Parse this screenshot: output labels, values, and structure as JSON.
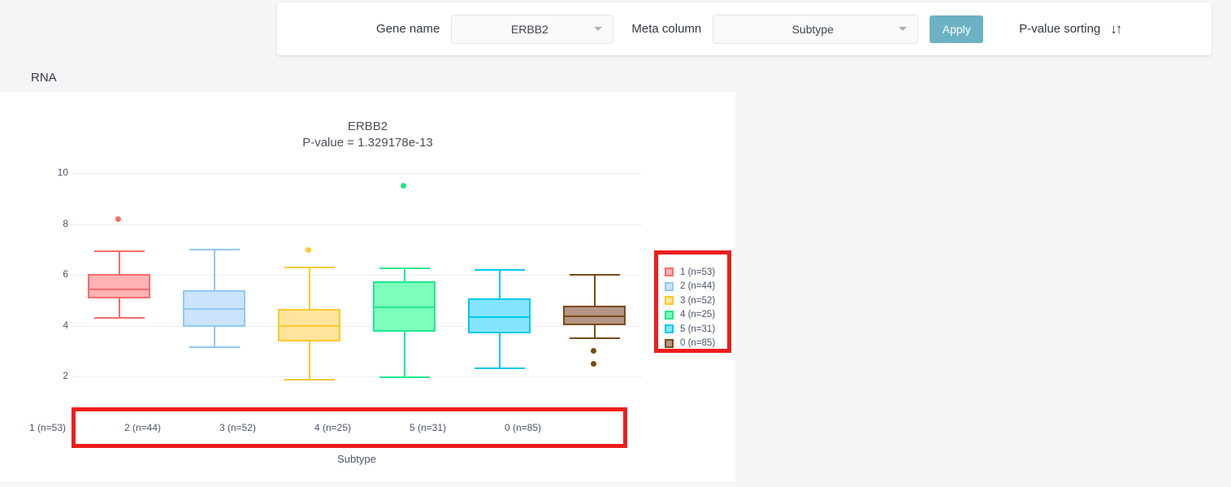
{
  "toolbar": {
    "gene_label": "Gene name",
    "gene_value": "ERBB2",
    "meta_label": "Meta column",
    "meta_value": "Subtype",
    "apply_label": "Apply",
    "pvalue_sorting_label": "P-value sorting",
    "sort_icon": "↓↑"
  },
  "section": {
    "title": "RNA"
  },
  "chart_data": {
    "type": "box",
    "title": "ERBB2",
    "subtitle": "P-value = 1.329178e-13",
    "xlabel": "Subtype",
    "ylabel": "",
    "ylim": [
      2,
      10.6
    ],
    "yticks": [
      2,
      4,
      6,
      8,
      10
    ],
    "grid": true,
    "legend_position": "right",
    "categories": [
      "1 (n=53)",
      "2 (n=44)",
      "3 (n=52)",
      "4 (n=25)",
      "5 (n=31)",
      "0 (n=85)"
    ],
    "legend": [
      {
        "label": "1 (n=53)",
        "fill": "#FFB3B3",
        "stroke": "#FF6B6B"
      },
      {
        "label": "2 (n=44)",
        "fill": "#CBE4FB",
        "stroke": "#8FC8F7"
      },
      {
        "label": "3 (n=52)",
        "fill": "#FFE59B",
        "stroke": "#FFC92E"
      },
      {
        "label": "4 (n=25)",
        "fill": "#7DFFBE",
        "stroke": "#1FE98B"
      },
      {
        "label": "5 (n=31)",
        "fill": "#85E5FF",
        "stroke": "#00C8F0"
      },
      {
        "label": "0 (n=85)",
        "fill": "#B49686",
        "stroke": "#7B4B16"
      }
    ],
    "boxes": [
      {
        "name": "1 (n=53)",
        "fill": "#FFB3B3",
        "stroke": "#FF6B6B",
        "whisker_low": 4.33,
        "q1": 5.08,
        "median": 5.47,
        "q3": 6.02,
        "whisker_high": 6.96,
        "outliers": [
          8.22
        ]
      },
      {
        "name": "2 (n=44)",
        "fill": "#CBE4FB",
        "stroke": "#8FC8F7",
        "whisker_low": 3.2,
        "q1": 3.95,
        "median": 4.7,
        "q3": 5.39,
        "whisker_high": 7.02,
        "outliers": []
      },
      {
        "name": "3 (n=52)",
        "fill": "#FFE59B",
        "stroke": "#FFC92E",
        "whisker_low": 1.9,
        "q1": 3.38,
        "median": 4.02,
        "q3": 4.66,
        "whisker_high": 6.32,
        "outliers": [
          6.99
        ]
      },
      {
        "name": "4 (n=25)",
        "fill": "#7DFFBE",
        "stroke": "#1FE98B",
        "whisker_low": 2.0,
        "q1": 3.76,
        "median": 4.75,
        "q3": 5.74,
        "whisker_high": 6.29,
        "outliers": [
          9.52
        ]
      },
      {
        "name": "5 (n=31)",
        "fill": "#85E5FF",
        "stroke": "#00C8F0",
        "whisker_low": 2.35,
        "q1": 3.7,
        "median": 4.37,
        "q3": 5.07,
        "whisker_high": 6.22,
        "outliers": []
      },
      {
        "name": "0 (n=85)",
        "fill": "#B49686",
        "stroke": "#7B4B16",
        "whisker_low": 3.53,
        "q1": 4.02,
        "median": 4.4,
        "q3": 4.8,
        "whisker_high": 6.03,
        "outliers": [
          3.03,
          2.52
        ]
      }
    ]
  },
  "colors": {
    "page_background": "#f4f5f7",
    "panel_background": "#ffffff",
    "accent": "#6cb2c4",
    "highlight": "#ef1d1d"
  }
}
